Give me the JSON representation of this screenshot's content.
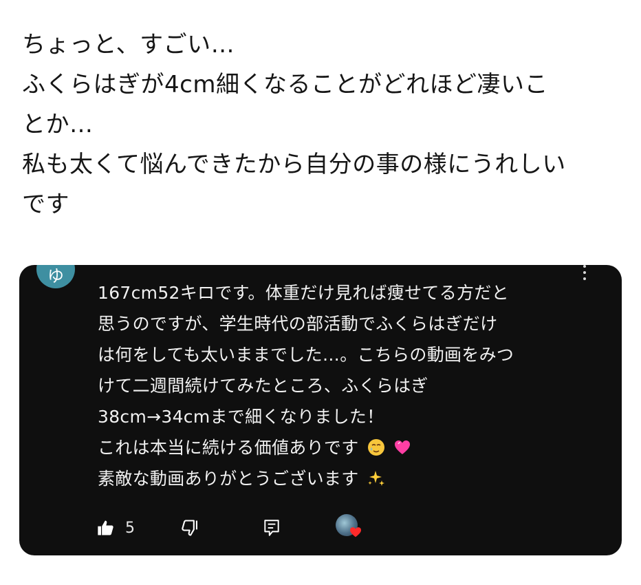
{
  "post": {
    "lines": [
      "ちょっと、すごい…",
      "ふくらはぎが4cm細くなることがどれほど凄いこ",
      "とか…",
      "私も太くて悩んできたから自分の事の様にうれしい",
      "です"
    ]
  },
  "comment": {
    "avatar_letter": "ゆ",
    "body_lines": [
      "167cm52キロです。体重だけ見れば痩せてる方だと",
      "思うのですが、学生時代の部活動でふくらはぎだけ",
      "は何をしても太いままでした…。こちらの動画をみつ",
      "けて二週間続けてみたところ、ふくらはぎ",
      "38cm→34cmまで細くなりました！",
      "これは本当に続ける価値ありです",
      "素敵な動画ありがとうございます"
    ],
    "like_count": "5",
    "icons": {
      "like": "thumbs-up-icon",
      "dislike": "thumbs-down-icon",
      "reply": "reply-comment-icon",
      "more": "more-vertical-icon",
      "crying_emoji": "smiling-face-with-tear-emoji",
      "heart_emoji": "beating-heart-emoji",
      "sparkles_emoji": "sparkles-emoji",
      "creator_heart": "creator-heart-icon"
    }
  }
}
